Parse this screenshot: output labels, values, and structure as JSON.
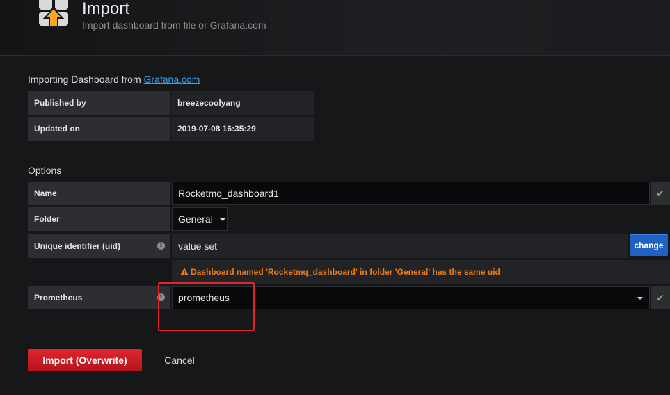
{
  "header": {
    "title": "Import",
    "subtitle": "Import dashboard from file or Grafana.com",
    "logo_icon": "import-dashboard-icon"
  },
  "source": {
    "prefix": "Importing Dashboard from ",
    "link_text": "Grafana.com"
  },
  "info": [
    {
      "label": "Published by",
      "value": "breezecoolyang"
    },
    {
      "label": "Updated on",
      "value": "2019-07-08 16:35:29"
    }
  ],
  "options": {
    "title": "Options",
    "name_label": "Name",
    "name_value": "Rocketmq_dashboard1",
    "folder_label": "Folder",
    "folder_value": "General",
    "uid_label": "Unique identifier (uid)",
    "uid_value": "value set",
    "change_label": "change",
    "warning": "Dashboard named 'Rocketmq_dashboard' in folder 'General' has the same uid",
    "prometheus_label": "Prometheus",
    "prometheus_value": "prometheus"
  },
  "actions": {
    "import_label": "Import (Overwrite)",
    "cancel_label": "Cancel"
  },
  "colors": {
    "accent_link": "#33a2e5",
    "success": "#7eb26d",
    "warning": "#eb7b18",
    "danger": "#e0242c",
    "primary": "#1f62c4"
  }
}
